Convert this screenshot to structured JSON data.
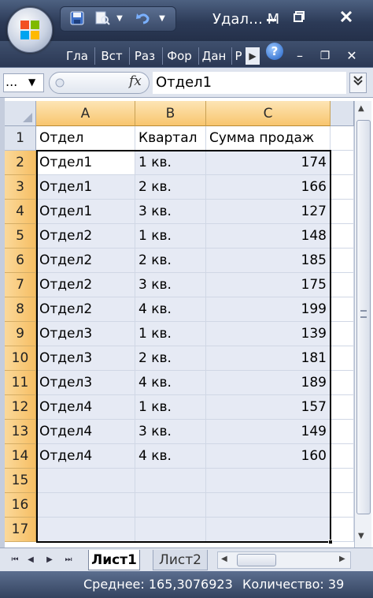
{
  "window": {
    "title": "Удал… М",
    "minimize_icon": "minimize-icon",
    "maximize_icon": "maximize-icon",
    "close_icon": "close-icon"
  },
  "quick_access": {
    "save_icon": "save-icon",
    "print_preview_icon": "print-preview-icon",
    "undo_icon": "undo-icon"
  },
  "ribbon": {
    "tabs": [
      "Гла",
      "Вст",
      "Раз",
      "Фор",
      "Дан",
      "Р"
    ],
    "help_label": "?"
  },
  "formula_bar": {
    "name_box": "...",
    "fx_label": "fx",
    "value": "Отдел1"
  },
  "columns": [
    "A",
    "B",
    "C"
  ],
  "rows": [
    {
      "num": "1",
      "cells": [
        "Отдел",
        "Квартал",
        "Сумма продаж"
      ]
    },
    {
      "num": "2",
      "cells": [
        "Отдел1",
        "1 кв.",
        "174"
      ]
    },
    {
      "num": "3",
      "cells": [
        "Отдел1",
        "2 кв.",
        "166"
      ]
    },
    {
      "num": "4",
      "cells": [
        "Отдел1",
        "3 кв.",
        "127"
      ]
    },
    {
      "num": "5",
      "cells": [
        "Отдел2",
        "1 кв.",
        "148"
      ]
    },
    {
      "num": "6",
      "cells": [
        "Отдел2",
        "2 кв.",
        "185"
      ]
    },
    {
      "num": "7",
      "cells": [
        "Отдел2",
        "3 кв.",
        "175"
      ]
    },
    {
      "num": "8",
      "cells": [
        "Отдел2",
        "4 кв.",
        "199"
      ]
    },
    {
      "num": "9",
      "cells": [
        "Отдел3",
        "1 кв.",
        "139"
      ]
    },
    {
      "num": "10",
      "cells": [
        "Отдел3",
        "2 кв.",
        "181"
      ]
    },
    {
      "num": "11",
      "cells": [
        "Отдел3",
        "4 кв.",
        "189"
      ]
    },
    {
      "num": "12",
      "cells": [
        "Отдел4",
        "1 кв.",
        "157"
      ]
    },
    {
      "num": "13",
      "cells": [
        "Отдел4",
        "3 кв.",
        "149"
      ]
    },
    {
      "num": "14",
      "cells": [
        "Отдел4",
        "4 кв.",
        "160"
      ]
    },
    {
      "num": "15",
      "cells": [
        "",
        "",
        ""
      ]
    },
    {
      "num": "16",
      "cells": [
        "",
        "",
        ""
      ]
    },
    {
      "num": "17",
      "cells": [
        "",
        "",
        ""
      ]
    }
  ],
  "sheets": [
    "Лист1",
    "Лист2"
  ],
  "status": {
    "average": "Среднее: 165,3076923",
    "count": "Количество: 39"
  },
  "colors": {
    "selection_fill": "#e6eaf4",
    "header_highlight": "#f8c56e",
    "titlebar": "#2c3a57"
  }
}
